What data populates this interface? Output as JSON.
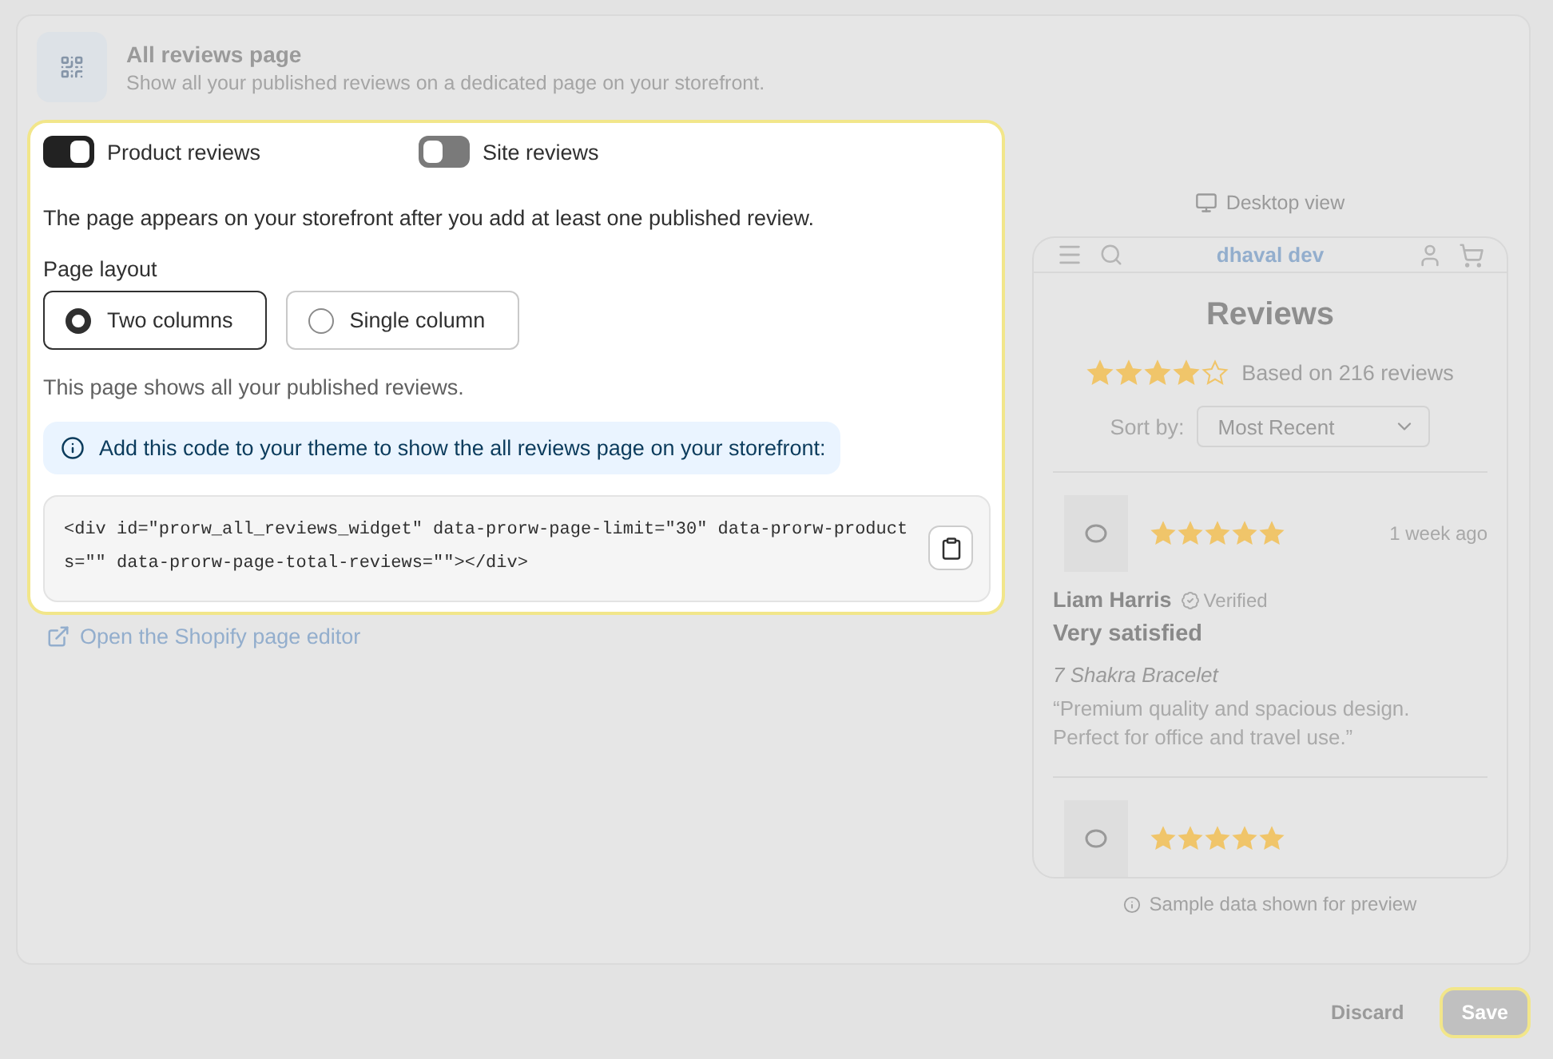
{
  "header": {
    "title": "All reviews page",
    "subtitle": "Show all your published reviews on a dedicated page on your storefront."
  },
  "toggles": [
    {
      "label": "Product reviews",
      "on": true
    },
    {
      "label": "Site reviews",
      "on": false
    }
  ],
  "notice": "The page appears on your storefront after you add at least one published review.",
  "layout": {
    "label": "Page layout",
    "options": [
      {
        "label": "Two columns",
        "selected": true
      },
      {
        "label": "Single column",
        "selected": false
      }
    ]
  },
  "layout_hint": "This page shows all your published reviews.",
  "info_banner": "Add this code to your theme to show the all reviews page on your storefront:",
  "code": "<div id=\"prorw_all_reviews_widget\" data-prorw-page-limit=\"30\" data-prorw-products=\"\" data-prorw-page-total-reviews=\"\"></div>",
  "editor_link": "Open the Shopify page editor",
  "preview": {
    "view_label": "Desktop view",
    "store_name": "dhaval dev",
    "title": "Reviews",
    "stars": 4,
    "summary": "Based on 216 reviews",
    "sort_label": "Sort by:",
    "sort_value": "Most Recent",
    "reviews": [
      {
        "stars": 5,
        "time": "1 week ago",
        "author": "Liam Harris",
        "badge": "Verified",
        "headline": "Very satisfied",
        "product": "7 Shakra Bracelet",
        "body": "“Premium quality and spacious design. Perfect for office and travel use.”"
      },
      {
        "stars": 5
      }
    ],
    "footnote": "Sample data shown for preview"
  },
  "actions": {
    "discard": "Discard",
    "save": "Save"
  }
}
